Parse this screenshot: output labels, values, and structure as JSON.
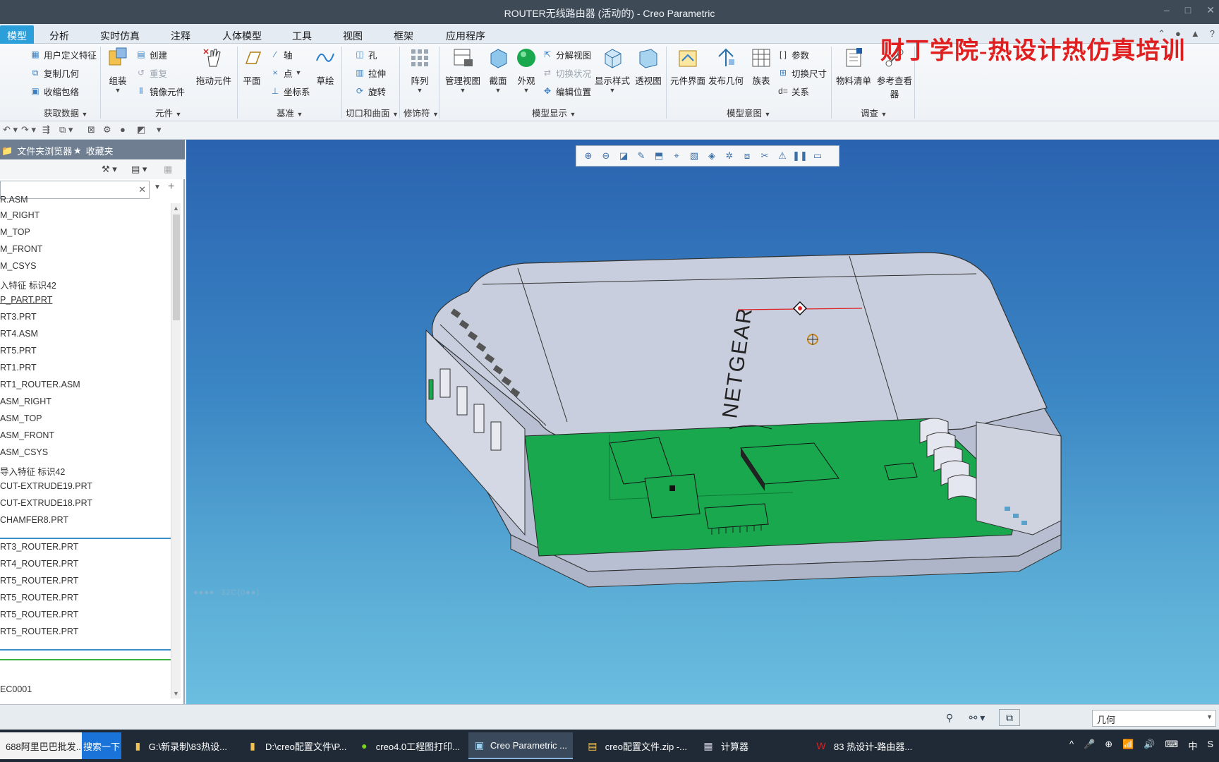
{
  "window": {
    "title": "ROUTER无线路由器 (活动的) - Creo Parametric",
    "controls": [
      "–",
      "□",
      "✕"
    ]
  },
  "ribbon_tabs": [
    "模型",
    "分析",
    "实时仿真",
    "注释",
    "人体模型",
    "工具",
    "视图",
    "框架",
    "应用程序"
  ],
  "ribbon": {
    "get_data": {
      "items": [
        "用户定义特征",
        "复制几何",
        "收缩包络"
      ],
      "group": "获取数据"
    },
    "components": {
      "assemble": "组装",
      "create": "创建",
      "repeat": "重复",
      "mirror": "镜像元件",
      "drag": "拖动元件",
      "group": "元件"
    },
    "datum": {
      "plane": "平面",
      "axis": "轴",
      "point": "点",
      "csys": "坐标系",
      "sketch": "草绘",
      "group": "基准"
    },
    "cut_surface": {
      "hole": "孔",
      "extrude": "拉伸",
      "revolve": "旋转",
      "group": "切口和曲面"
    },
    "modifiers": {
      "pattern": "阵列",
      "group": "修饰符"
    },
    "model_display": {
      "manage_views": "管理视图",
      "section": "截面",
      "appearance": "外观",
      "explode": "分解视图",
      "toggle_state": "切换状况",
      "edit_position": "编辑位置",
      "display_style": "显示样式",
      "perspective": "透视图",
      "group": "模型显示"
    },
    "model_intent": {
      "component_interface": "元件界面",
      "publish_geom": "发布几何",
      "family_table": "族表",
      "params": "参数",
      "switch_dim": "切换尺寸",
      "relations": "关系",
      "group": "模型意图"
    },
    "investigate": {
      "bom": "物料清单",
      "ref_viewer": "参考查看器",
      "group": "调查"
    }
  },
  "watermark": "财丁学院-热设计热仿真培训",
  "left_panel": {
    "tabs": [
      "文件夹浏览器",
      "收藏夹"
    ],
    "tree_items_top": [
      "R.ASM",
      "M_RIGHT",
      "M_TOP",
      "M_FRONT",
      "M_CSYS",
      "入特征 标识42",
      "P_PART.PRT",
      "RT3.PRT",
      "RT4.ASM",
      "RT5.PRT",
      "RT1.PRT",
      "RT1_ROUTER.ASM",
      "ASM_RIGHT",
      "ASM_TOP",
      "ASM_FRONT",
      "ASM_CSYS",
      "导入特征 标识42",
      "CUT-EXTRUDE19.PRT",
      "CUT-EXTRUDE18.PRT",
      "CHAMFER8.PRT"
    ],
    "tree_items_mid": [
      "RT3_ROUTER.PRT",
      "RT4_ROUTER.PRT",
      "RT5_ROUTER.PRT",
      "RT5_ROUTER.PRT",
      "RT5_ROUTER.PRT",
      "RT5_ROUTER.PRT"
    ],
    "tree_items_bottom": [
      "EC0001"
    ]
  },
  "viewport": {
    "brand_text": "NETGEAR",
    "coord_text": "●●●● ·32C(0●●)"
  },
  "statusbar": {
    "filter_value": "几何"
  },
  "taskbar": {
    "items": [
      "688阿里巴巴批发...",
      "G:\\新录制\\83热设...",
      "D:\\creo配置文件\\P...",
      "creo4.0工程图打印...",
      "Creo Parametric ...",
      "creo配置文件.zip -...",
      "计算器",
      "83 热设计-路由器..."
    ],
    "search": "搜索一下",
    "tray": [
      "^",
      "🎤",
      "⊕",
      "📶",
      "🔊",
      "⌨",
      "中",
      "S"
    ]
  },
  "colors": {
    "accent": "#2b9fd9",
    "pcb_green": "#1aa84f",
    "enclosure": "#c9cede",
    "watermark": "#e02020"
  }
}
